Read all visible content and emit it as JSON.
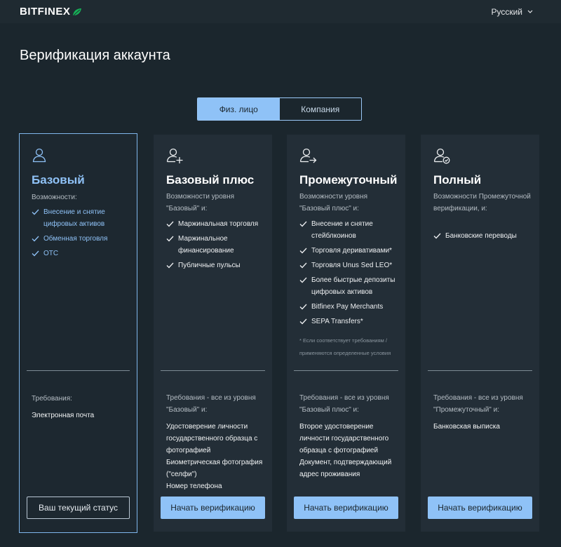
{
  "header": {
    "logo_text": "BITFINEX",
    "language": "Русский"
  },
  "page": {
    "title": "Верификация аккаунта"
  },
  "account_type": {
    "options": [
      {
        "label": "Физ. лицо",
        "active": true
      },
      {
        "label": "Компания",
        "active": false
      }
    ]
  },
  "colors": {
    "accent": "#8fc2f7",
    "background": "#1b262d",
    "card": "#232e37",
    "brand_leaf": "#16b157"
  },
  "levels": [
    {
      "icon": "user-icon",
      "title": "Базовый",
      "features_label": "Возможности:",
      "features": [
        "Внесение и снятие цифровых активов",
        "Обменная торговля",
        "OTC"
      ],
      "footnote": "",
      "requirements_label": "Требования:",
      "requirements": [
        "Электронная почта"
      ],
      "button": "Ваш текущий статус",
      "current": true
    },
    {
      "icon": "user-plus-icon",
      "title": "Базовый плюс",
      "features_label": "Возможности уровня \"Базовый\" и:",
      "features": [
        "Маржинальная торговля",
        "Маржинальное финансирование",
        "Публичные пульсы"
      ],
      "footnote": "",
      "requirements_label": "Требования - все из уровня \"Базовый\" и:",
      "requirements": [
        "Удостоверение личности государственного образца с фотографией",
        "Биометрическая фотография (\"селфи\")",
        "Номер телефона"
      ],
      "button": "Начать верификацию",
      "current": false
    },
    {
      "icon": "user-arrow-icon",
      "title": "Промежуточный",
      "features_label": "Возможности уровня \"Базовый плюс\" и:",
      "features": [
        "Внесение и снятие стейблкоинов",
        "Торговля деривативами*",
        "Торговля Unus Sed LEO*",
        "Более быстрые депозиты цифровых активов",
        "Bitfinex Pay Merchants",
        "SEPA Transfers*"
      ],
      "footnote": "* Если соответствует требованиям / применяются определенные условия",
      "requirements_label": "Требования - все из уровня \"Базовый плюс\" и:",
      "requirements": [
        "Второе удостоверение личности государственного образца с фотографией",
        "Документ, подтверждающий адрес проживания"
      ],
      "button": "Начать верификацию",
      "current": false
    },
    {
      "icon": "user-check-icon",
      "title": "Полный",
      "features_label": "Возможности Промежуточной верификации, и:",
      "features": [
        "Банковские переводы"
      ],
      "footnote": "",
      "requirements_label": "Требования - все из уровня \"Промежуточный\" и:",
      "requirements": [
        "Банковская выписка"
      ],
      "button": "Начать верификацию",
      "current": false
    }
  ]
}
